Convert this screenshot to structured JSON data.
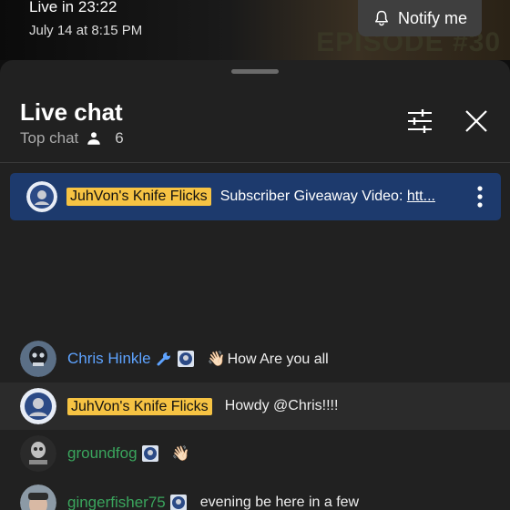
{
  "video": {
    "live_in": "Live in 23:22",
    "scheduled": "July 14 at 8:15 PM",
    "notify_label": "Notify me",
    "thumbnail_text": "EPISODE #30"
  },
  "chat": {
    "title": "Live chat",
    "mode": "Top chat",
    "viewer_count": "6"
  },
  "pinned": {
    "author": "JuhVon's Knife Flicks",
    "message": "Subscriber Giveaway Video: ",
    "link_text": "htt..."
  },
  "messages": [
    {
      "author": "Chris Hinkle",
      "emoji": "👋🏻",
      "text": "How Are you all",
      "author_color": "#5ea3ff"
    },
    {
      "author": "JuhVon's Knife Flicks",
      "text": "Howdy @Chris!!!!"
    },
    {
      "author": "groundfog",
      "emoji": "👋🏻",
      "text": "",
      "author_color": "#3aa55d"
    },
    {
      "author": "gingerfisher75",
      "text": "evening be here in a few",
      "author_color": "#3aa55d"
    }
  ],
  "colors": {
    "owner_badge": "#f6c343",
    "pinned_bg": "#1d3a6d",
    "sheet_bg": "#212121"
  },
  "icons": [
    "bell-icon",
    "person-icon",
    "tune-icon",
    "close-icon",
    "more-vert-icon",
    "wrench-icon",
    "member-badge-icon"
  ]
}
